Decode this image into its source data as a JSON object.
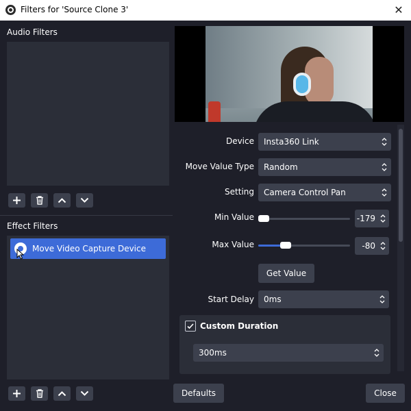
{
  "window": {
    "title": "Filters for 'Source Clone 3'",
    "close_glyph": "✕"
  },
  "audio_filters": {
    "label": "Audio Filters",
    "items": []
  },
  "effect_filters": {
    "label": "Effect Filters",
    "items": [
      {
        "label": "Move Video Capture Device",
        "selected": true,
        "visible": true
      }
    ]
  },
  "properties": {
    "device": {
      "label": "Device",
      "value": "Insta360 Link"
    },
    "move_value_type": {
      "label": "Move Value Type",
      "value": "Random"
    },
    "setting": {
      "label": "Setting",
      "value": "Camera Control Pan"
    },
    "min_value": {
      "label": "Min Value",
      "value": "-179"
    },
    "max_value": {
      "label": "Max Value",
      "value": "-80"
    },
    "get_value_button": "Get Value",
    "start_delay": {
      "label": "Start Delay",
      "value": "0ms"
    },
    "custom_duration": {
      "label": "Custom Duration",
      "checked": true,
      "value": "300ms"
    }
  },
  "footer": {
    "defaults_button": "Defaults",
    "close_button": "Close"
  },
  "colors": {
    "background": "#1e1f29",
    "panel": "#2b2e38",
    "control": "#3c404d",
    "accent": "#3d6bd8"
  }
}
